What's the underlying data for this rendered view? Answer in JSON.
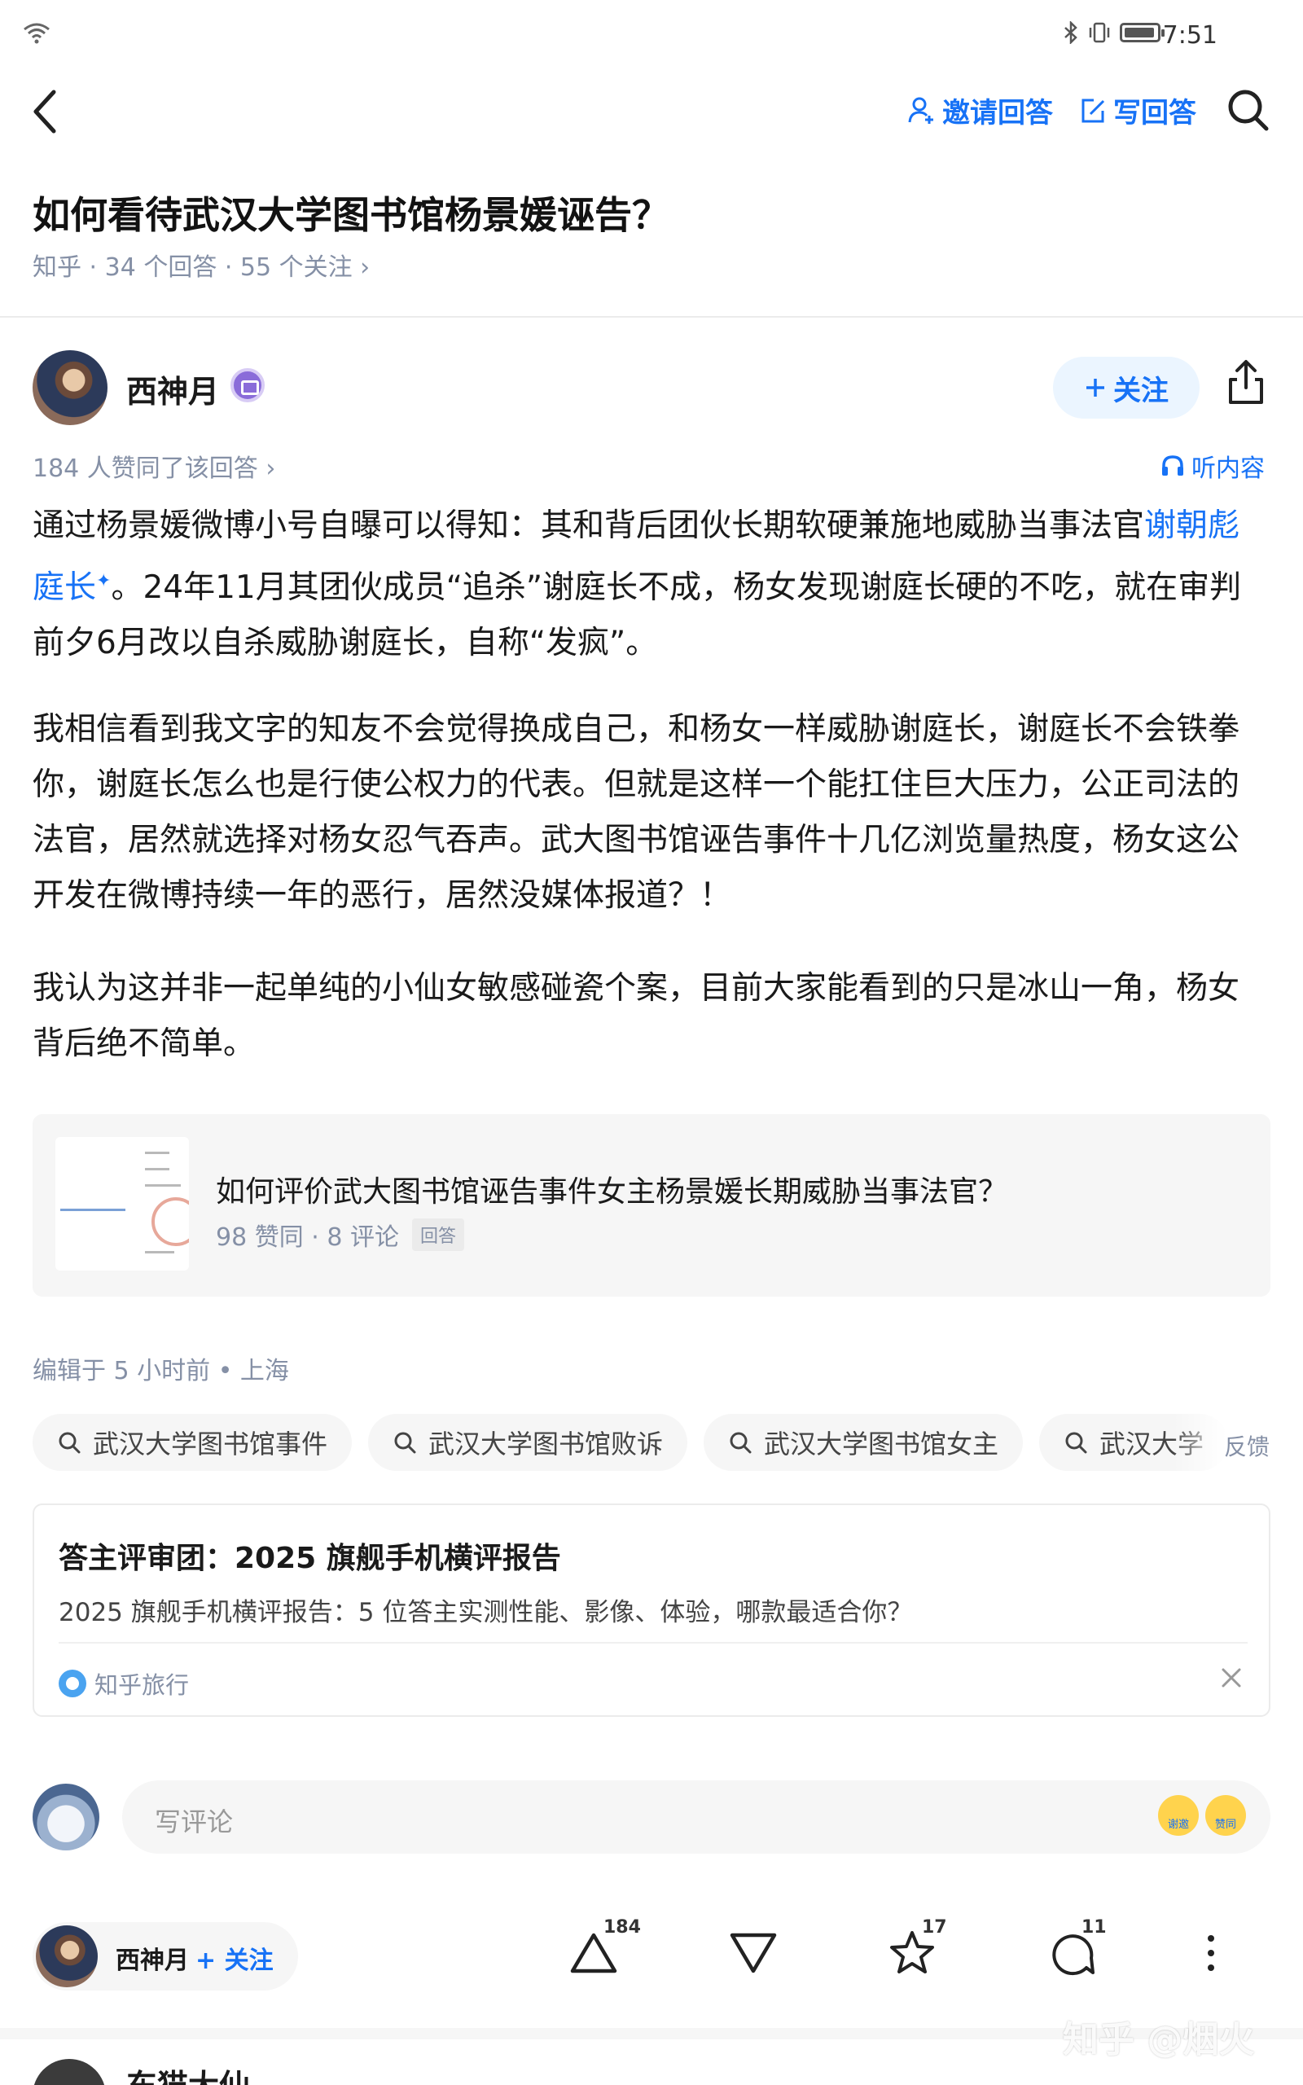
{
  "status_bar": {
    "time": "7:51"
  },
  "top_bar": {
    "invite_label": "邀请回答",
    "write_label": "写回答"
  },
  "question": {
    "title": "如何看待武汉大学图书馆杨景媛诬告？",
    "meta": "知乎 · 34 个回答 · 55 个关注 ›"
  },
  "author": {
    "name": "西神月",
    "follow_label": "关注",
    "likes_line": "184 人赞同了该回答 ›",
    "listen_label": "听内容"
  },
  "answer": {
    "p1_before": "通过杨景媛微博小号自曝可以得知：其和背后团伙长期软硬兼施地威胁当事法官",
    "p1_link": "谢朝彪庭长",
    "p1_after": "。24年11月其团伙成员“追杀”谢庭长不成，杨女发现谢庭长硬的不吃，就在审判前夕6月改以自杀威胁谢庭长，自称“发疯”。",
    "p2": "我相信看到我文字的知友不会觉得换成自己，和杨女一样威胁谢庭长，谢庭长不会铁拳你，谢庭长怎么也是行使公权力的代表。但就是这样一个能扛住巨大压力，公正司法的法官，居然就选择对杨女忍气吞声。武大图书馆诬告事件十几亿浏览量热度，杨女这公开发在微博持续一年的恶行，居然没媒体报道？！",
    "p3": "我认为这并非一起单纯的小仙女敏感碰瓷个案，目前大家能看到的只是冰山一角，杨女背后绝不简单。"
  },
  "linked_card": {
    "title": "如何评价武大图书馆诬告事件女主杨景媛长期威胁当事法官？",
    "meta": "98 赞同 · 8 评论",
    "tag": "回答"
  },
  "edited": "编辑于 5 小时前 • 上海",
  "search_chips": [
    "武汉大学图书馆事件",
    "武汉大学图书馆败诉",
    "武汉大学图书馆女主",
    "武汉大学"
  ],
  "feedback_label": "反馈",
  "promo": {
    "title": "答主评审团：2025 旗舰手机横评报告",
    "desc": "2025 旗舰手机横评报告：5 位答主实测性能、影像、体验，哪款最适合你？",
    "source": "知乎旅行"
  },
  "comment": {
    "placeholder": "写评论",
    "emoji_1": "谢邀",
    "emoji_2": "赞同"
  },
  "bottom_bar": {
    "author_name": "西神月",
    "follow_label": "+ 关注",
    "upvote_count": "184",
    "favorite_count": "17",
    "comment_count": "11"
  },
  "watermark": "知乎 @烟火",
  "next_answer": {
    "author_name": "东猫大仙"
  },
  "colors": {
    "accent": "#1772f6",
    "muted": "#8590a6",
    "chip_bg": "#f6f6f6"
  }
}
